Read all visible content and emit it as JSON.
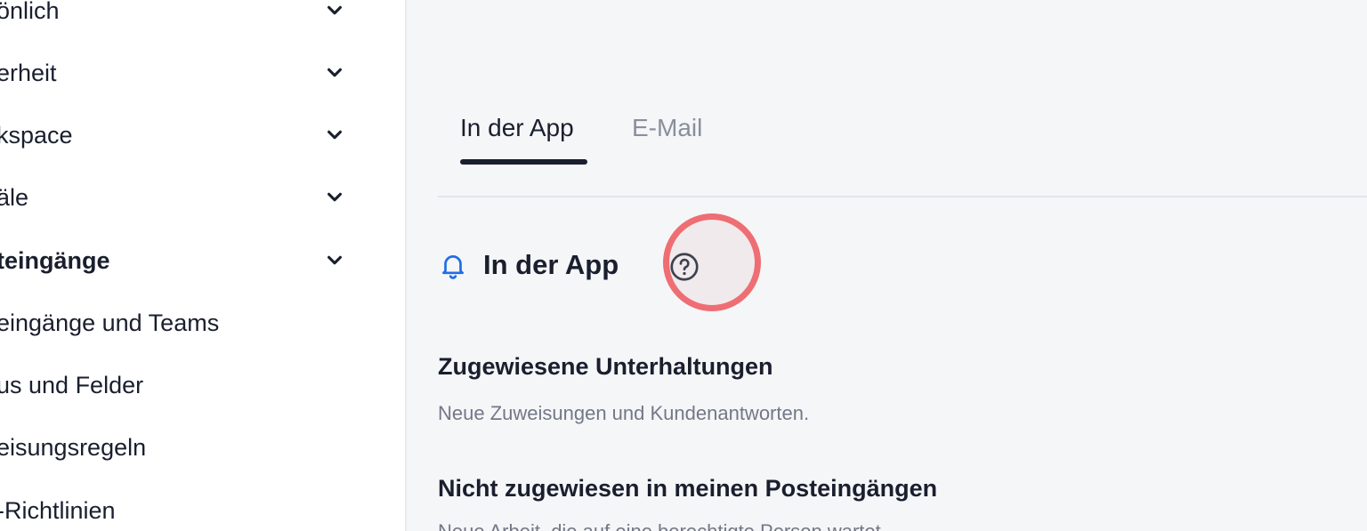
{
  "sidebar": {
    "sections": [
      {
        "label": "önlich",
        "expanded": false
      },
      {
        "label": "erheit",
        "expanded": false
      },
      {
        "label": "kspace",
        "expanded": false
      },
      {
        "label": "äle",
        "expanded": false
      },
      {
        "label": "teingänge",
        "expanded": true
      }
    ],
    "sub_items": [
      {
        "label": "eingänge und Teams"
      },
      {
        "label": "us und Felder"
      },
      {
        "label": "eisungsregeln"
      },
      {
        "label": "-Richtlinien"
      }
    ]
  },
  "main": {
    "tabs": [
      {
        "label": "In der App",
        "active": true
      },
      {
        "label": "E-Mail",
        "active": false
      }
    ],
    "section": {
      "title": "In der App",
      "icon": "bell-icon",
      "help_icon": "question-circle-icon"
    },
    "preferences": [
      {
        "title": "Zugewiesene Unterhaltungen",
        "description": "Neue Zuweisungen und Kundenantworten."
      },
      {
        "title": "Nicht zugewiesen in meinen Posteingängen",
        "description": "Neue Arbeit, die auf eine berechtigte Person wartet."
      }
    ]
  },
  "colors": {
    "accent": "#1f6fe5",
    "highlight_ring": "#ee6e73",
    "text_primary": "#1a1f2e",
    "text_muted": "#737887",
    "background": "#f5f6f8"
  }
}
